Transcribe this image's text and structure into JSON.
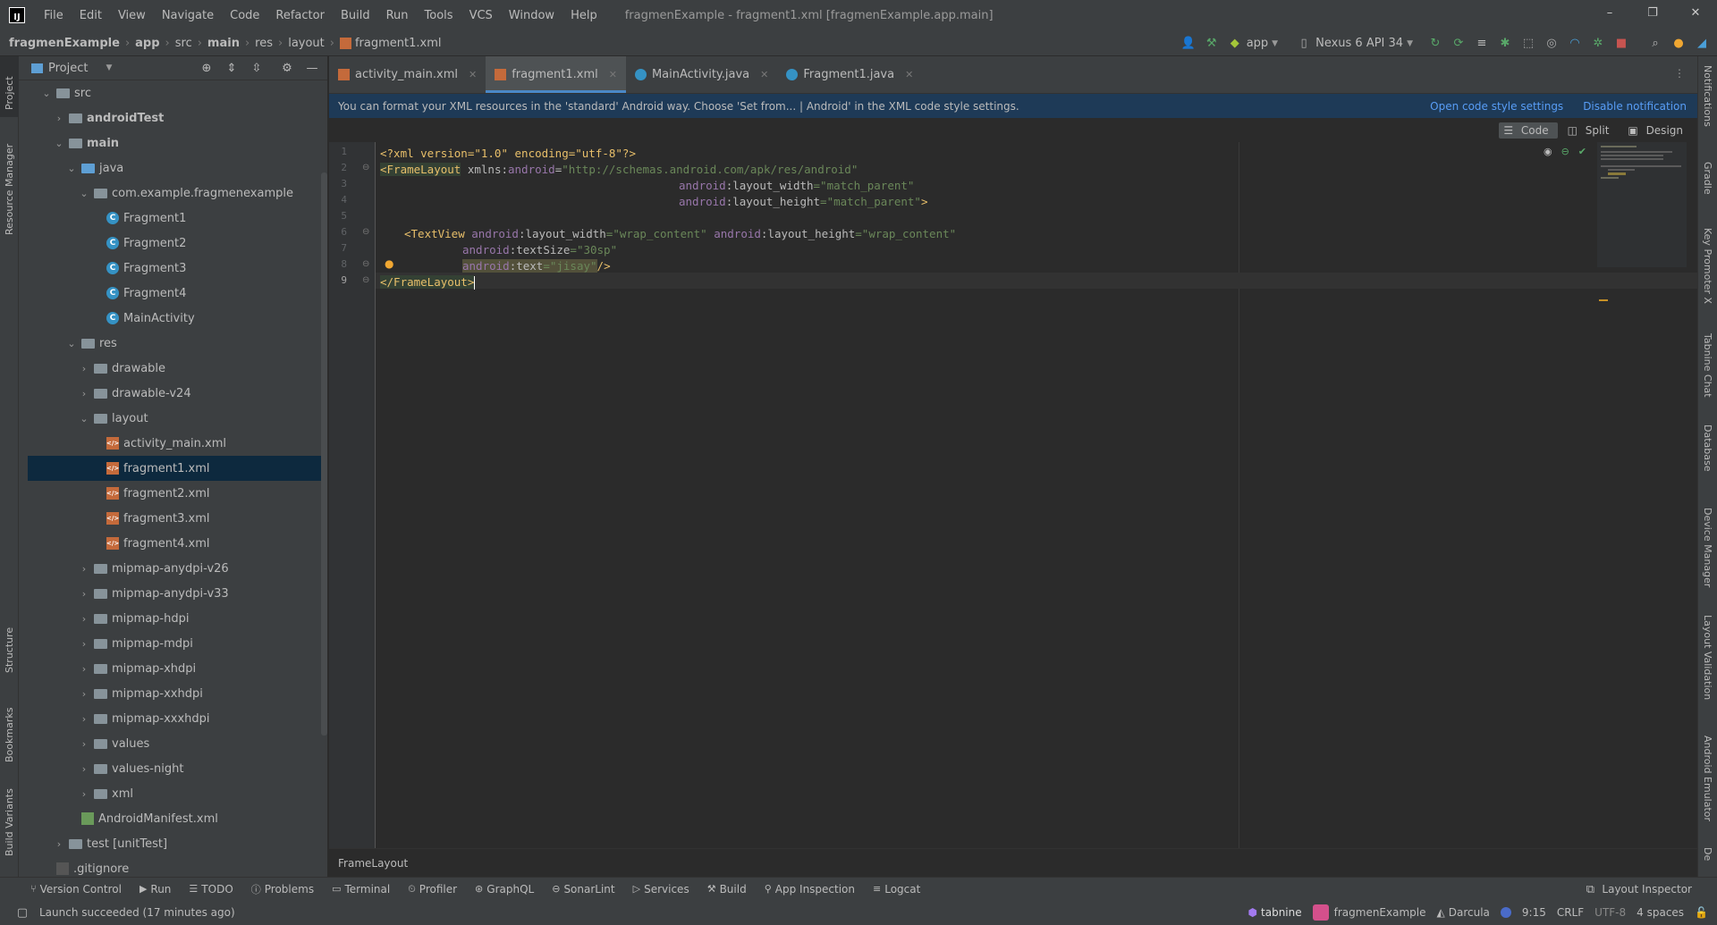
{
  "menubar": {
    "logo": "IJ",
    "items": [
      "File",
      "Edit",
      "View",
      "Navigate",
      "Code",
      "Refactor",
      "Build",
      "Run",
      "Tools",
      "VCS",
      "Window",
      "Help"
    ],
    "window_title": "fragmenExample - fragment1.xml [fragmenExample.app.main]",
    "win_min": "–",
    "win_max": "❐",
    "win_close": "✕"
  },
  "navbar": {
    "crumbs": [
      "fragmenExample",
      "app",
      "src",
      "main",
      "res",
      "layout",
      "fragment1.xml"
    ],
    "run_config": "app",
    "device": "Nexus 6 API 34"
  },
  "project_panel": {
    "title": "Project",
    "tree": [
      {
        "label": "src",
        "depth": 1,
        "arrow": "open",
        "icon": "folder"
      },
      {
        "label": "androidTest",
        "depth": 2,
        "arrow": "closed",
        "icon": "folder",
        "bold": true
      },
      {
        "label": "main",
        "depth": 2,
        "arrow": "open",
        "icon": "folder",
        "bold": true
      },
      {
        "label": "java",
        "depth": 3,
        "arrow": "open",
        "icon": "folder-blue"
      },
      {
        "label": "com.example.fragmenexample",
        "depth": 4,
        "arrow": "open",
        "icon": "package"
      },
      {
        "label": "Fragment1",
        "depth": 5,
        "arrow": "none",
        "icon": "class"
      },
      {
        "label": "Fragment2",
        "depth": 5,
        "arrow": "none",
        "icon": "class"
      },
      {
        "label": "Fragment3",
        "depth": 5,
        "arrow": "none",
        "icon": "class"
      },
      {
        "label": "Fragment4",
        "depth": 5,
        "arrow": "none",
        "icon": "class"
      },
      {
        "label": "MainActivity",
        "depth": 5,
        "arrow": "none",
        "icon": "class"
      },
      {
        "label": "res",
        "depth": 3,
        "arrow": "open",
        "icon": "folder-res"
      },
      {
        "label": "drawable",
        "depth": 4,
        "arrow": "closed",
        "icon": "folder"
      },
      {
        "label": "drawable-v24",
        "depth": 4,
        "arrow": "closed",
        "icon": "folder"
      },
      {
        "label": "layout",
        "depth": 4,
        "arrow": "open",
        "icon": "folder"
      },
      {
        "label": "activity_main.xml",
        "depth": 5,
        "arrow": "none",
        "icon": "xml"
      },
      {
        "label": "fragment1.xml",
        "depth": 5,
        "arrow": "none",
        "icon": "xml",
        "selected": true
      },
      {
        "label": "fragment2.xml",
        "depth": 5,
        "arrow": "none",
        "icon": "xml"
      },
      {
        "label": "fragment3.xml",
        "depth": 5,
        "arrow": "none",
        "icon": "xml"
      },
      {
        "label": "fragment4.xml",
        "depth": 5,
        "arrow": "none",
        "icon": "xml"
      },
      {
        "label": "mipmap-anydpi-v26",
        "depth": 4,
        "arrow": "closed",
        "icon": "folder"
      },
      {
        "label": "mipmap-anydpi-v33",
        "depth": 4,
        "arrow": "closed",
        "icon": "folder"
      },
      {
        "label": "mipmap-hdpi",
        "depth": 4,
        "arrow": "closed",
        "icon": "folder"
      },
      {
        "label": "mipmap-mdpi",
        "depth": 4,
        "arrow": "closed",
        "icon": "folder"
      },
      {
        "label": "mipmap-xhdpi",
        "depth": 4,
        "arrow": "closed",
        "icon": "folder"
      },
      {
        "label": "mipmap-xxhdpi",
        "depth": 4,
        "arrow": "closed",
        "icon": "folder"
      },
      {
        "label": "mipmap-xxxhdpi",
        "depth": 4,
        "arrow": "closed",
        "icon": "folder"
      },
      {
        "label": "values",
        "depth": 4,
        "arrow": "closed",
        "icon": "folder"
      },
      {
        "label": "values-night",
        "depth": 4,
        "arrow": "closed",
        "icon": "folder"
      },
      {
        "label": "xml",
        "depth": 4,
        "arrow": "closed",
        "icon": "folder"
      },
      {
        "label": "AndroidManifest.xml",
        "depth": 3,
        "arrow": "none",
        "icon": "manifest"
      },
      {
        "label": "test [unitTest]",
        "depth": 2,
        "arrow": "closed",
        "icon": "folder"
      },
      {
        "label": ".gitignore",
        "depth": 1,
        "arrow": "none",
        "icon": "gitignore"
      }
    ]
  },
  "left_stripe": [
    "Project",
    "Resource Manager",
    "Structure",
    "Bookmarks",
    "Build Variants"
  ],
  "right_stripe": [
    "Notifications",
    "Gradle",
    "Key Promoter X",
    "Tabnine Chat",
    "Database",
    "Device Manager",
    "Layout Validation",
    "Android Emulator",
    "De"
  ],
  "tabs": [
    {
      "label": "activity_main.xml",
      "icon": "xml",
      "active": false
    },
    {
      "label": "fragment1.xml",
      "icon": "xml",
      "active": true
    },
    {
      "label": "MainActivity.java",
      "icon": "java",
      "active": false
    },
    {
      "label": "Fragment1.java",
      "icon": "java",
      "active": false
    }
  ],
  "notice": {
    "text": "You can format your XML resources in the 'standard' Android way. Choose 'Set from... | Android' in the XML code style settings.",
    "link1": "Open code style settings",
    "link2": "Disable notification"
  },
  "view_modes": {
    "code": "Code",
    "split": "Split",
    "design": "Design"
  },
  "line_numbers": [
    "1",
    "2",
    "3",
    "4",
    "5",
    "6",
    "7",
    "8",
    "9"
  ],
  "code": {
    "l1_a": "<?xml version=\"1.0\" encoding=\"utf-8\"?>",
    "l2_tag": "<FrameLayout",
    "l2_ns": " xmlns:",
    "l2_attr": "android",
    "l2_eq": "=",
    "l2_val": "\"http://schemas.android.com/apk/res/android\"",
    "l3_ns": "android",
    "l3_attr": ":layout_width",
    "l3_val": "=\"match_parent\"",
    "l4_ns": "android",
    "l4_attr": ":layout_height",
    "l4_val": "=\"match_parent\"",
    "l4_end": ">",
    "l6_tag": "<TextView",
    "l6_ns1": "android",
    "l6_a1": ":layout_width",
    "l6_v1": "=\"wrap_content\"",
    "l6_ns2": "android",
    "l6_a2": ":layout_height",
    "l6_v2": "=\"wrap_content\"",
    "l7_ns": "android",
    "l7_attr": ":textSize",
    "l7_val": "=\"30sp\"",
    "l8_ns": "android",
    "l8_attr": ":text",
    "l8_val": "=\"jisay\"",
    "l8_end": "/>",
    "l9": "</FrameLayout>"
  },
  "editor_breadcrumb": "FrameLayout",
  "tool_windows": [
    "Version Control",
    "Run",
    "TODO",
    "Problems",
    "Terminal",
    "Profiler",
    "GraphQL",
    "SonarLint",
    "Services",
    "Build",
    "App Inspection",
    "Logcat"
  ],
  "layout_inspector": "Layout Inspector",
  "status": {
    "message": "Launch succeeded (17 minutes ago)",
    "tabnine": "tabnine",
    "project": "fragmenExample",
    "theme": "Darcula",
    "position": "9:15",
    "line_sep": "CRLF",
    "encoding": "UTF-8",
    "indent": "4 spaces"
  }
}
